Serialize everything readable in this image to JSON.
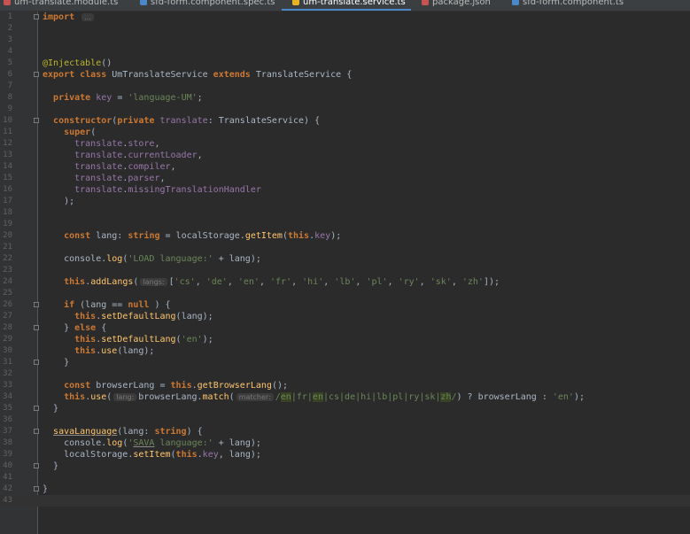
{
  "tabs": [
    {
      "label": "um-translate.module.ts",
      "color": "#c75450"
    },
    {
      "label": "sfd-form.component.spec.ts",
      "color": "#4a88c7"
    },
    {
      "label": "um-translate.service.ts",
      "color": "#e6b422",
      "active": true
    },
    {
      "label": "package.json",
      "color": "#c75450"
    },
    {
      "label": "sfd-form.component.ts",
      "color": "#4a88c7"
    }
  ],
  "lines": [
    {
      "n": "1",
      "html": "<span class=\"kw\">import</span> <span class=\"hint\">...</span>",
      "fold": true
    },
    {
      "n": "2",
      "html": ""
    },
    {
      "n": "3",
      "html": ""
    },
    {
      "n": "4",
      "html": ""
    },
    {
      "n": "5",
      "html": "<span class=\"ann\">@Injectable</span>()"
    },
    {
      "n": "6",
      "html": "<span class=\"kw\">export class</span> UmTranslateService <span class=\"kw\">extends</span> TranslateService {",
      "fold": true
    },
    {
      "n": "7",
      "html": ""
    },
    {
      "n": "8",
      "html": "  <span class=\"kw\">private</span> <span class=\"fld\">key</span> = <span class=\"str\">'language-UM'</span>;"
    },
    {
      "n": "9",
      "html": ""
    },
    {
      "n": "10",
      "html": "  <span class=\"kw\">constructor</span>(<span class=\"kw\">private</span> <span class=\"fld\">translate</span>: TranslateService) {",
      "fold": true
    },
    {
      "n": "11",
      "html": "    <span class=\"kw\">super</span>("
    },
    {
      "n": "12",
      "html": "      <span class=\"fld\">translate</span>.<span class=\"fld\">store</span>,"
    },
    {
      "n": "13",
      "html": "      <span class=\"fld\">translate</span>.<span class=\"fld\">currentLoader</span>,"
    },
    {
      "n": "14",
      "html": "      <span class=\"fld\">translate</span>.<span class=\"fld\">compiler</span>,"
    },
    {
      "n": "15",
      "html": "      <span class=\"fld\">translate</span>.<span class=\"fld\">parser</span>,"
    },
    {
      "n": "16",
      "html": "      <span class=\"fld\">translate</span>.<span class=\"fld\">missingTranslationHandler</span>"
    },
    {
      "n": "17",
      "html": "    );"
    },
    {
      "n": "18",
      "html": ""
    },
    {
      "n": "19",
      "html": ""
    },
    {
      "n": "20",
      "html": "    <span class=\"kw\">const</span> lang: <span class=\"kw\">string</span> = localStorage.<span class=\"fn\">getItem</span>(<span class=\"kw\">this</span>.<span class=\"fld\">key</span>);"
    },
    {
      "n": "21",
      "html": ""
    },
    {
      "n": "22",
      "html": "    console.<span class=\"fn\">log</span>(<span class=\"str\">'LOAD language:'</span> + lang);"
    },
    {
      "n": "23",
      "html": ""
    },
    {
      "n": "24",
      "html": "    <span class=\"kw\">this</span>.<span class=\"fn\">addLangs</span>(<span class=\"hint\">langs:</span>[<span class=\"str\">'cs'</span>, <span class=\"str\">'de'</span>, <span class=\"str\">'en'</span>, <span class=\"str\">'fr'</span>, <span class=\"str\">'hi'</span>, <span class=\"str\">'lb'</span>, <span class=\"str\">'pl'</span>, <span class=\"str\">'ry'</span>, <span class=\"str\">'sk'</span>, <span class=\"str\">'zh'</span>]);"
    },
    {
      "n": "25",
      "html": ""
    },
    {
      "n": "26",
      "html": "    <span class=\"kw\">if</span> (lang == <span class=\"kw\">null</span> ) {",
      "fold": true
    },
    {
      "n": "27",
      "html": "      <span class=\"kw\">this</span>.<span class=\"fn\">setDefaultLang</span>(lang);"
    },
    {
      "n": "28",
      "html": "    } <span class=\"kw\">else</span> {",
      "fold": true
    },
    {
      "n": "29",
      "html": "      <span class=\"kw\">this</span>.<span class=\"fn\">setDefaultLang</span>(<span class=\"str\">'en'</span>);"
    },
    {
      "n": "30",
      "html": "      <span class=\"kw\">this</span>.<span class=\"fn\">use</span>(lang);"
    },
    {
      "n": "31",
      "html": "    }",
      "fold": true
    },
    {
      "n": "32",
      "html": ""
    },
    {
      "n": "33",
      "html": "    <span class=\"kw\">const</span> browserLang = <span class=\"kw\">this</span>.<span class=\"fn\">getBrowserLang</span>();"
    },
    {
      "n": "34",
      "html": "    <span class=\"kw\">this</span>.<span class=\"fn\">use</span>(<span class=\"hint\">lang:</span>browserLang.<span class=\"fn\">match</span>(<span class=\"hint\">matcher:</span><span class=\"str\">/</span><span class=\"rxh\">en</span><span class=\"str\">|fr|</span><span class=\"rxh\">en</span><span class=\"str\">|cs|de|hi|lb|pl|ry|sk|</span><span class=\"rxh\">zh</span><span class=\"str\">/</span>) ? browserLang : <span class=\"str\">'en'</span>);"
    },
    {
      "n": "35",
      "html": "  }",
      "fold": true
    },
    {
      "n": "36",
      "html": ""
    },
    {
      "n": "37",
      "html": "  <span class=\"fn uline\">savaLanguage</span>(lang: <span class=\"kw\">string</span>) {",
      "fold": true
    },
    {
      "n": "38",
      "html": "    console.<span class=\"fn\">log</span>(<span class=\"str\">'<span class=\"uline\">SAVA</span> language:'</span> + lang);"
    },
    {
      "n": "39",
      "html": "    localStorage.<span class=\"fn\">setItem</span>(<span class=\"kw\">this</span>.<span class=\"fld\">key</span>, lang);"
    },
    {
      "n": "40",
      "html": "  }",
      "fold": true
    },
    {
      "n": "41",
      "html": ""
    },
    {
      "n": "42",
      "html": "}",
      "fold": true
    },
    {
      "n": "43",
      "html": "",
      "current": true
    }
  ]
}
